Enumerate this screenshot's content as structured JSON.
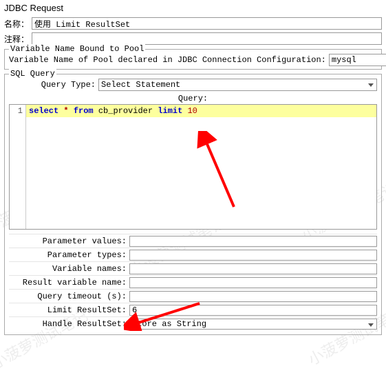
{
  "title": "JDBC Request",
  "name_label": "名称：",
  "name_value": "使用 Limit ResultSet",
  "comment_label": "注释：",
  "comment_value": "",
  "var_section": {
    "legend": "Variable Name Bound to Pool",
    "pool_label": "Variable Name of Pool declared in JDBC Connection Configuration:",
    "pool_value": "mysql"
  },
  "sql": {
    "legend": "SQL Query",
    "query_type_label": "Query Type:",
    "query_type_value": "Select Statement",
    "query_label": "Query:",
    "code_tokens": {
      "select": "select",
      "star": "*",
      "from": "from",
      "table": "cb_provider",
      "limit": "limit",
      "num": "10"
    },
    "gutter": "1",
    "params": {
      "pvalues_label": "Parameter values:",
      "ptypes_label": "Parameter types:",
      "vnames_label": "Variable names:",
      "rvar_label": "Result variable name:",
      "qtimeout_label": "Query timeout (s):",
      "limitrs_label": "Limit ResultSet:",
      "limitrs_value": "6",
      "handlers_label": "Handle ResultSet:",
      "handlers_value": "Store as String"
    }
  },
  "watermark": "小菠萝测试笔记"
}
